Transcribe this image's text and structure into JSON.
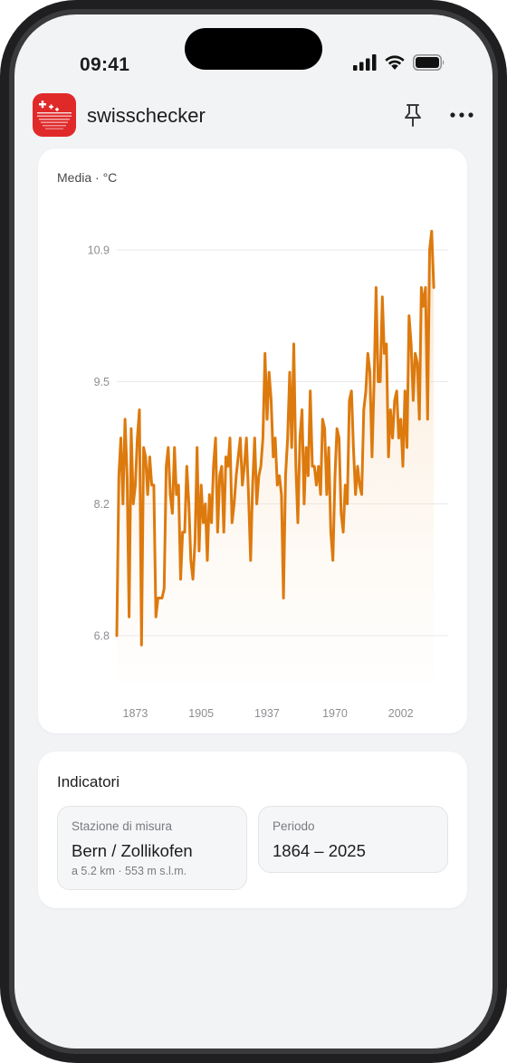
{
  "status_bar": {
    "time": "09:41"
  },
  "app": {
    "name": "swisschecker"
  },
  "chart_card": {
    "title": "Media · °C"
  },
  "chart_data": {
    "type": "area",
    "title": "Media · °C",
    "xlabel": "",
    "ylabel": "",
    "x_ticks": [
      "1873",
      "1905",
      "1937",
      "1970",
      "2002"
    ],
    "y_ticks": [
      "6.8",
      "8.2",
      "9.5",
      "10.9"
    ],
    "xlim": [
      1864,
      2025
    ],
    "ylim": [
      6.3,
      11.4
    ],
    "grid": true,
    "color": "#dd7a0e",
    "fill_color": "#f7d9b6",
    "series": [
      {
        "x_start": 1864,
        "values": [
          6.8,
          8.5,
          8.9,
          8.2,
          9.1,
          8.5,
          7.0,
          9.0,
          8.2,
          8.4,
          8.9,
          9.2,
          6.7,
          8.8,
          8.7,
          8.3,
          8.7,
          8.4,
          8.4,
          7.0,
          7.2,
          7.2,
          7.2,
          7.3,
          8.6,
          8.8,
          8.3,
          8.1,
          8.8,
          8.3,
          8.4,
          7.4,
          7.9,
          7.9,
          8.6,
          8.2,
          7.6,
          7.4,
          7.8,
          8.8,
          7.7,
          8.4,
          8.0,
          8.2,
          7.6,
          8.3,
          8.0,
          8.6,
          8.9,
          7.9,
          8.5,
          8.6,
          7.9,
          8.7,
          8.6,
          8.9,
          8.0,
          8.2,
          8.5,
          8.7,
          8.9,
          8.4,
          8.6,
          8.9,
          8.3,
          7.6,
          8.4,
          8.9,
          8.2,
          8.5,
          8.6,
          8.9,
          9.8,
          9.1,
          9.6,
          9.3,
          8.7,
          8.9,
          8.4,
          8.5,
          8.3,
          7.2,
          8.5,
          8.9,
          9.6,
          8.8,
          9.9,
          8.6,
          8.0,
          8.9,
          9.2,
          8.2,
          8.8,
          8.5,
          9.4,
          8.6,
          8.6,
          8.4,
          8.6,
          8.3,
          9.1,
          9.0,
          8.3,
          8.8,
          7.9,
          7.6,
          8.5,
          9.0,
          8.9,
          8.1,
          7.9,
          8.4,
          8.2,
          9.3,
          9.4,
          8.8,
          8.3,
          8.6,
          8.4,
          8.3,
          9.2,
          9.4,
          9.8,
          9.6,
          8.7,
          9.5,
          10.5,
          9.5,
          9.5,
          10.4,
          9.8,
          9.9,
          8.7,
          9.2,
          8.9,
          9.3,
          9.4,
          8.9,
          9.1,
          8.6,
          9.4,
          8.8,
          10.2,
          9.9,
          9.3,
          9.8,
          9.7,
          9.1,
          10.5,
          10.3,
          10.5,
          9.1,
          10.9,
          11.1,
          10.5
        ]
      }
    ]
  },
  "indicators": {
    "title": "Indicatori",
    "station": {
      "label": "Stazione di misura",
      "value": "Bern / Zollikofen",
      "sub": "a 5.2 km · 553 m s.l.m."
    },
    "period": {
      "label": "Periodo",
      "value": "1864 – 2025"
    }
  }
}
